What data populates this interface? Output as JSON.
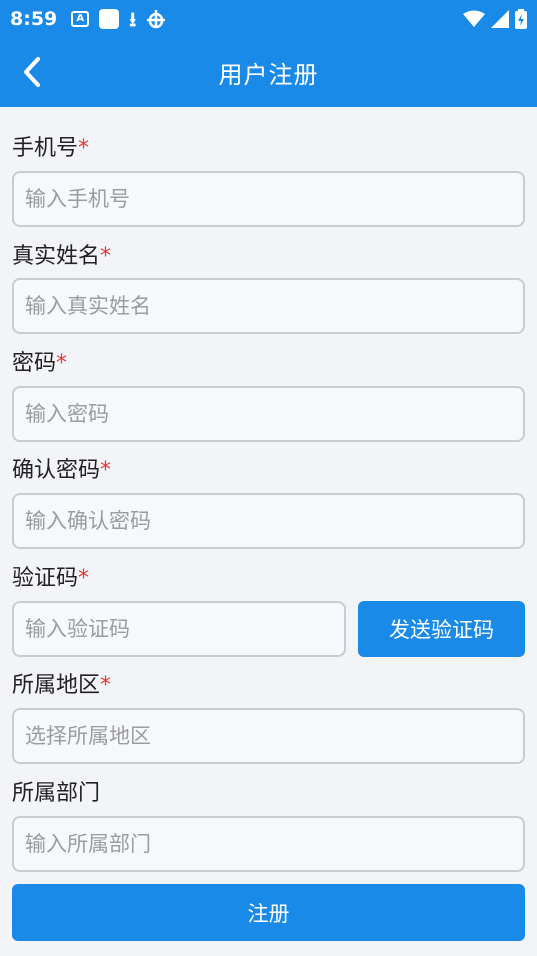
{
  "status_bar": {
    "time": "8:59",
    "icons": [
      "a-notification-icon",
      "app-notification-icon",
      "download-icon",
      "bug-icon",
      "wifi-icon",
      "signal-icon",
      "battery-icon"
    ]
  },
  "header": {
    "title": "用户注册"
  },
  "form": {
    "phone": {
      "label": "手机号",
      "required_mark": "*",
      "placeholder": "输入手机号"
    },
    "name": {
      "label": "真实姓名",
      "required_mark": "*",
      "placeholder": "输入真实姓名"
    },
    "password": {
      "label": "密码",
      "required_mark": "*",
      "placeholder": "输入密码"
    },
    "confirm_password": {
      "label": "确认密码",
      "required_mark": "*",
      "placeholder": "输入确认密码"
    },
    "code": {
      "label": "验证码",
      "required_mark": "*",
      "placeholder": "输入验证码",
      "send_button": "发送验证码"
    },
    "region": {
      "label": "所属地区",
      "required_mark": "*",
      "placeholder": "选择所属地区"
    },
    "department": {
      "label": "所属部门",
      "placeholder": "输入所属部门"
    },
    "submit_label": "注册"
  },
  "colors": {
    "primary": "#1a8ae8",
    "required": "#e53935"
  }
}
